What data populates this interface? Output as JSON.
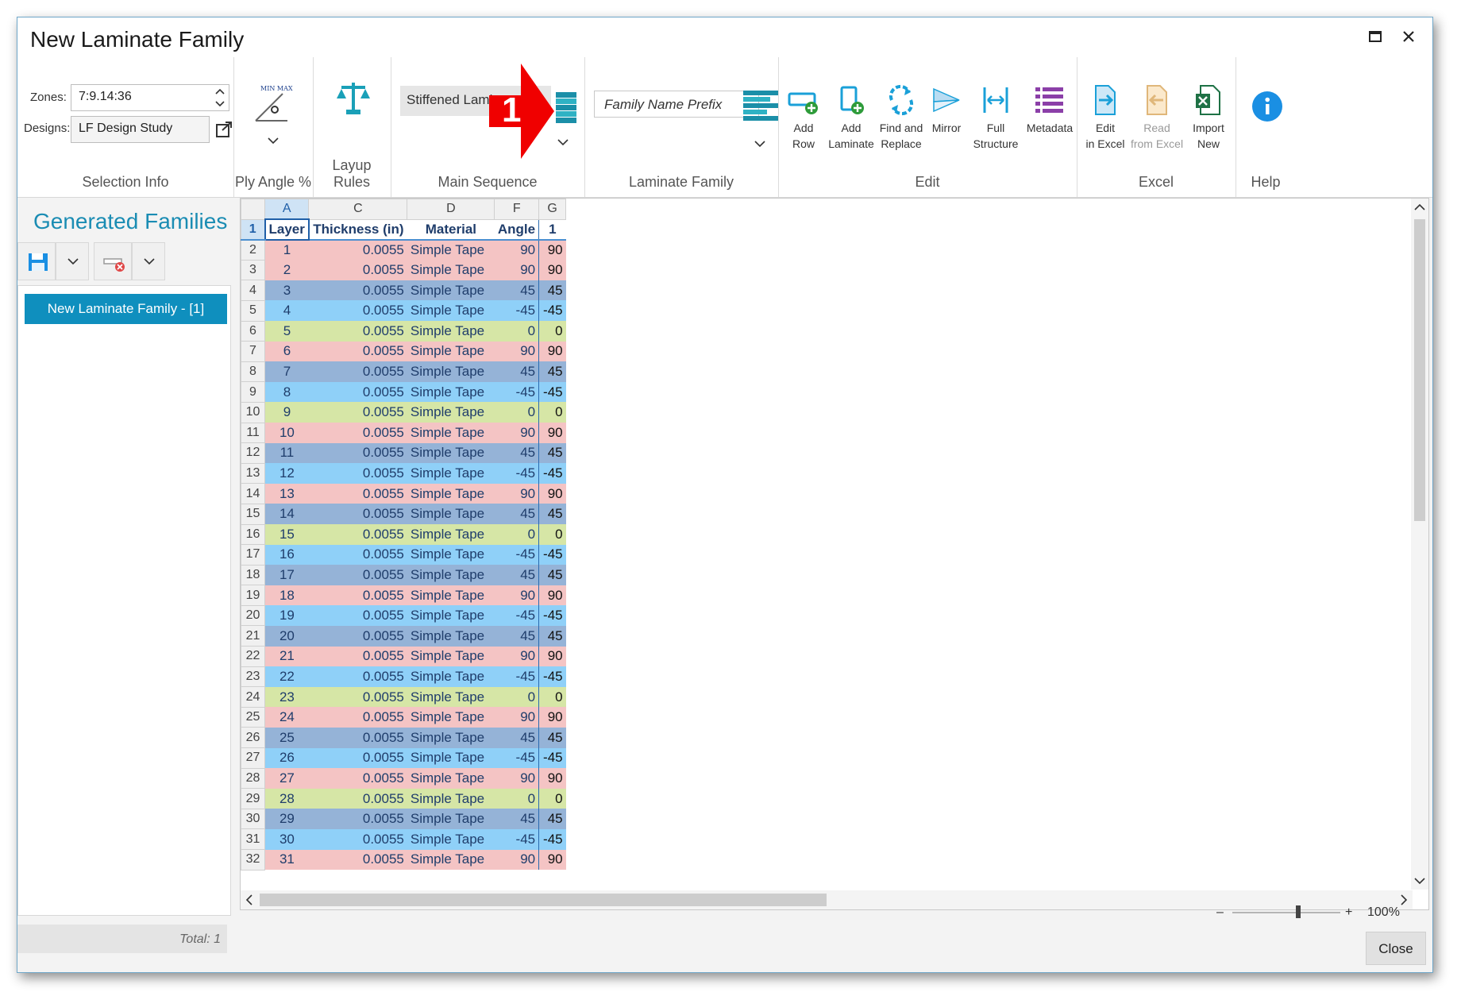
{
  "window": {
    "title": "New Laminate Family"
  },
  "ribbon": {
    "selection_info": {
      "zones_label": "Zones:",
      "zones_value": "7:9.14:36",
      "designs_label": "Designs:",
      "designs_value": "LF Design Study",
      "group_label": "Selection Info"
    },
    "ply_angle": {
      "icon_text": "MIN MAX",
      "group_label": "Ply Angle %"
    },
    "layup_rules": {
      "group_label": "Layup Rules"
    },
    "main_sequence": {
      "combo_value": "Stiffened Lamina",
      "group_label": "Main Sequence",
      "callout_number": "1"
    },
    "laminate_family": {
      "prefix_placeholder": "Family Name Prefix",
      "group_label": "Laminate Family"
    },
    "edit": {
      "group_label": "Edit",
      "buttons": [
        {
          "line1": "Add",
          "line2": "Row"
        },
        {
          "line1": "Add",
          "line2": "Laminate"
        },
        {
          "line1": "Find and",
          "line2": "Replace"
        },
        {
          "line1": "Mirror",
          "line2": ""
        },
        {
          "line1": "Full",
          "line2": "Structure"
        },
        {
          "line1": "Metadata",
          "line2": ""
        }
      ]
    },
    "excel": {
      "group_label": "Excel",
      "buttons": [
        {
          "line1": "Edit",
          "line2": "in Excel"
        },
        {
          "line1": "Read",
          "line2": "from Excel"
        },
        {
          "line1": "Import",
          "line2": "New"
        }
      ]
    },
    "help": {
      "group_label": "Help"
    }
  },
  "left_panel": {
    "title": "Generated Families",
    "items": [
      "New Laminate Family - [1]"
    ],
    "total": "Total: 1"
  },
  "grid": {
    "column_letters": [
      "A",
      "C",
      "D",
      "F",
      "G"
    ],
    "headers": [
      "Layer",
      "Thickness (in)",
      "Material",
      "Angle",
      "1"
    ],
    "rows": [
      [
        1,
        "0.0055",
        "Simple Tape",
        90,
        90
      ],
      [
        2,
        "0.0055",
        "Simple Tape",
        90,
        90
      ],
      [
        3,
        "0.0055",
        "Simple Tape",
        45,
        45
      ],
      [
        4,
        "0.0055",
        "Simple Tape",
        -45,
        -45
      ],
      [
        5,
        "0.0055",
        "Simple Tape",
        0,
        0
      ],
      [
        6,
        "0.0055",
        "Simple Tape",
        90,
        90
      ],
      [
        7,
        "0.0055",
        "Simple Tape",
        45,
        45
      ],
      [
        8,
        "0.0055",
        "Simple Tape",
        -45,
        -45
      ],
      [
        9,
        "0.0055",
        "Simple Tape",
        0,
        0
      ],
      [
        10,
        "0.0055",
        "Simple Tape",
        90,
        90
      ],
      [
        11,
        "0.0055",
        "Simple Tape",
        45,
        45
      ],
      [
        12,
        "0.0055",
        "Simple Tape",
        -45,
        -45
      ],
      [
        13,
        "0.0055",
        "Simple Tape",
        90,
        90
      ],
      [
        14,
        "0.0055",
        "Simple Tape",
        45,
        45
      ],
      [
        15,
        "0.0055",
        "Simple Tape",
        0,
        0
      ],
      [
        16,
        "0.0055",
        "Simple Tape",
        -45,
        -45
      ],
      [
        17,
        "0.0055",
        "Simple Tape",
        45,
        45
      ],
      [
        18,
        "0.0055",
        "Simple Tape",
        90,
        90
      ],
      [
        19,
        "0.0055",
        "Simple Tape",
        -45,
        -45
      ],
      [
        20,
        "0.0055",
        "Simple Tape",
        45,
        45
      ],
      [
        21,
        "0.0055",
        "Simple Tape",
        90,
        90
      ],
      [
        22,
        "0.0055",
        "Simple Tape",
        -45,
        -45
      ],
      [
        23,
        "0.0055",
        "Simple Tape",
        0,
        0
      ],
      [
        24,
        "0.0055",
        "Simple Tape",
        90,
        90
      ],
      [
        25,
        "0.0055",
        "Simple Tape",
        45,
        45
      ],
      [
        26,
        "0.0055",
        "Simple Tape",
        -45,
        -45
      ],
      [
        27,
        "0.0055",
        "Simple Tape",
        90,
        90
      ],
      [
        28,
        "0.0055",
        "Simple Tape",
        0,
        0
      ],
      [
        29,
        "0.0055",
        "Simple Tape",
        45,
        45
      ],
      [
        30,
        "0.0055",
        "Simple Tape",
        -45,
        -45
      ],
      [
        31,
        "0.0055",
        "Simple Tape",
        90,
        90
      ]
    ],
    "angle_colors": {
      "90": "#f4c4c4",
      "45": "#95b3d7",
      "-45": "#8fd0f8",
      "0": "#d6e6a6"
    }
  },
  "status": {
    "zoom_level": "100%",
    "close_label": "Close"
  }
}
